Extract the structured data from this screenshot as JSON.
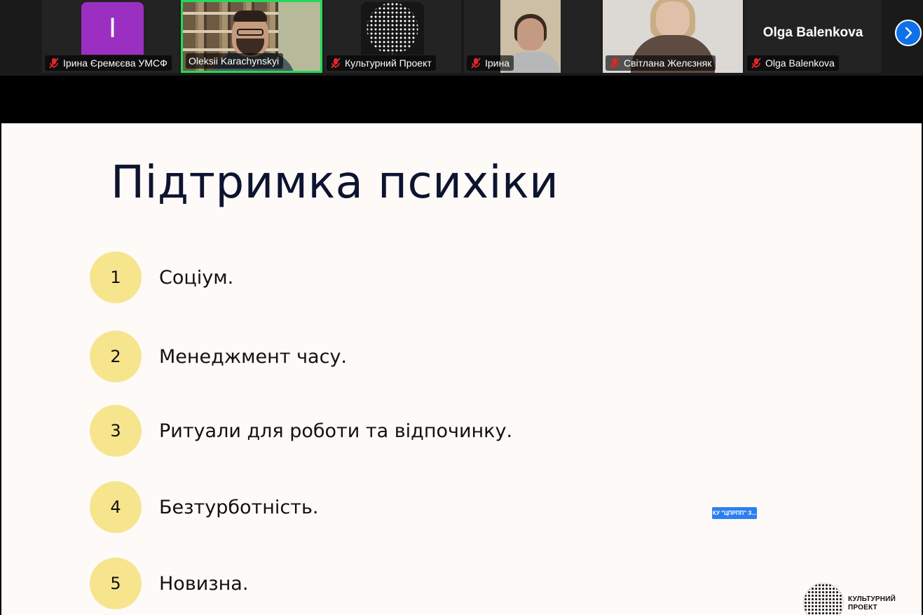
{
  "participants": [
    {
      "name": "Ірина Єремєєва УМСФ",
      "avatar_letter": "I",
      "muted": true
    },
    {
      "name": "Oleksii Karachynskyi",
      "muted": false,
      "active_speaker": true
    },
    {
      "name": "Культурний Проект",
      "muted": true
    },
    {
      "name": "Ірина",
      "muted": true
    },
    {
      "name": "Світлана Желєзняк",
      "muted": true
    },
    {
      "name": "Olga Balenkova",
      "muted": true,
      "display_name": "Olga Balenkova"
    }
  ],
  "icons": {
    "mic": "microphone-muted-icon",
    "next": "chevron-right-icon"
  },
  "colors": {
    "active_speaker_border": "#23d959",
    "mic_muted": "#e02828",
    "next_button": "#0e71eb",
    "number_circle": "#f7e58e",
    "slide_title": "#0d1430"
  },
  "slide": {
    "title": "Підтримка психіки",
    "items": [
      {
        "number": "1",
        "text": "Соціум."
      },
      {
        "number": "2",
        "text": "Менеджмент часу."
      },
      {
        "number": "3",
        "text": "Ритуали для роботи та відпочинку."
      },
      {
        "number": "4",
        "text": "Безтурботність."
      },
      {
        "number": "5",
        "text": "Новизна."
      }
    ],
    "overlay_tag": "КУ \"ЦПРПП\" З...",
    "brand_line1": "КУЛЬТУРНИЙ",
    "brand_line2": "ПРОЕКТ"
  }
}
